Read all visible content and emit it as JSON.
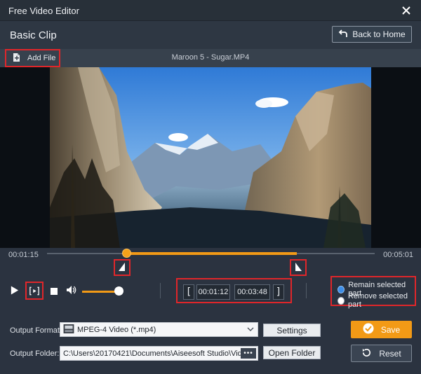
{
  "window": {
    "title": "Free Video Editor"
  },
  "header": {
    "title": "Basic Clip",
    "back_label": "Back to Home"
  },
  "filebar": {
    "add_file_label": "Add File",
    "file_name": "Maroon 5 - Sugar.MP4"
  },
  "timeline": {
    "current_time": "00:01:15",
    "total_time": "00:05:01",
    "selection_start_fraction": 0.243,
    "selection_end_fraction": 0.762
  },
  "controls": {
    "volume_level": 0.85,
    "start_time": "00:01:12",
    "end_time": "00:03:48",
    "mode_options": [
      {
        "label": "Remain selected part",
        "selected": true
      },
      {
        "label": "Remove selected part",
        "selected": false
      }
    ]
  },
  "output": {
    "format_label": "Output Format:",
    "format_value": "MPEG-4 Video (*.mp4)",
    "settings_label": "Settings",
    "folder_label": "Output Folder:",
    "folder_path": "C:\\Users\\20170421\\Documents\\Aiseesoft Studio\\Video",
    "open_folder_label": "Open Folder",
    "browse_label": "•••"
  },
  "actions": {
    "save_label": "Save",
    "reset_label": "Reset"
  },
  "colors": {
    "accent": "#f29a16",
    "highlight": "#e0262a",
    "background": "#2b3340"
  }
}
